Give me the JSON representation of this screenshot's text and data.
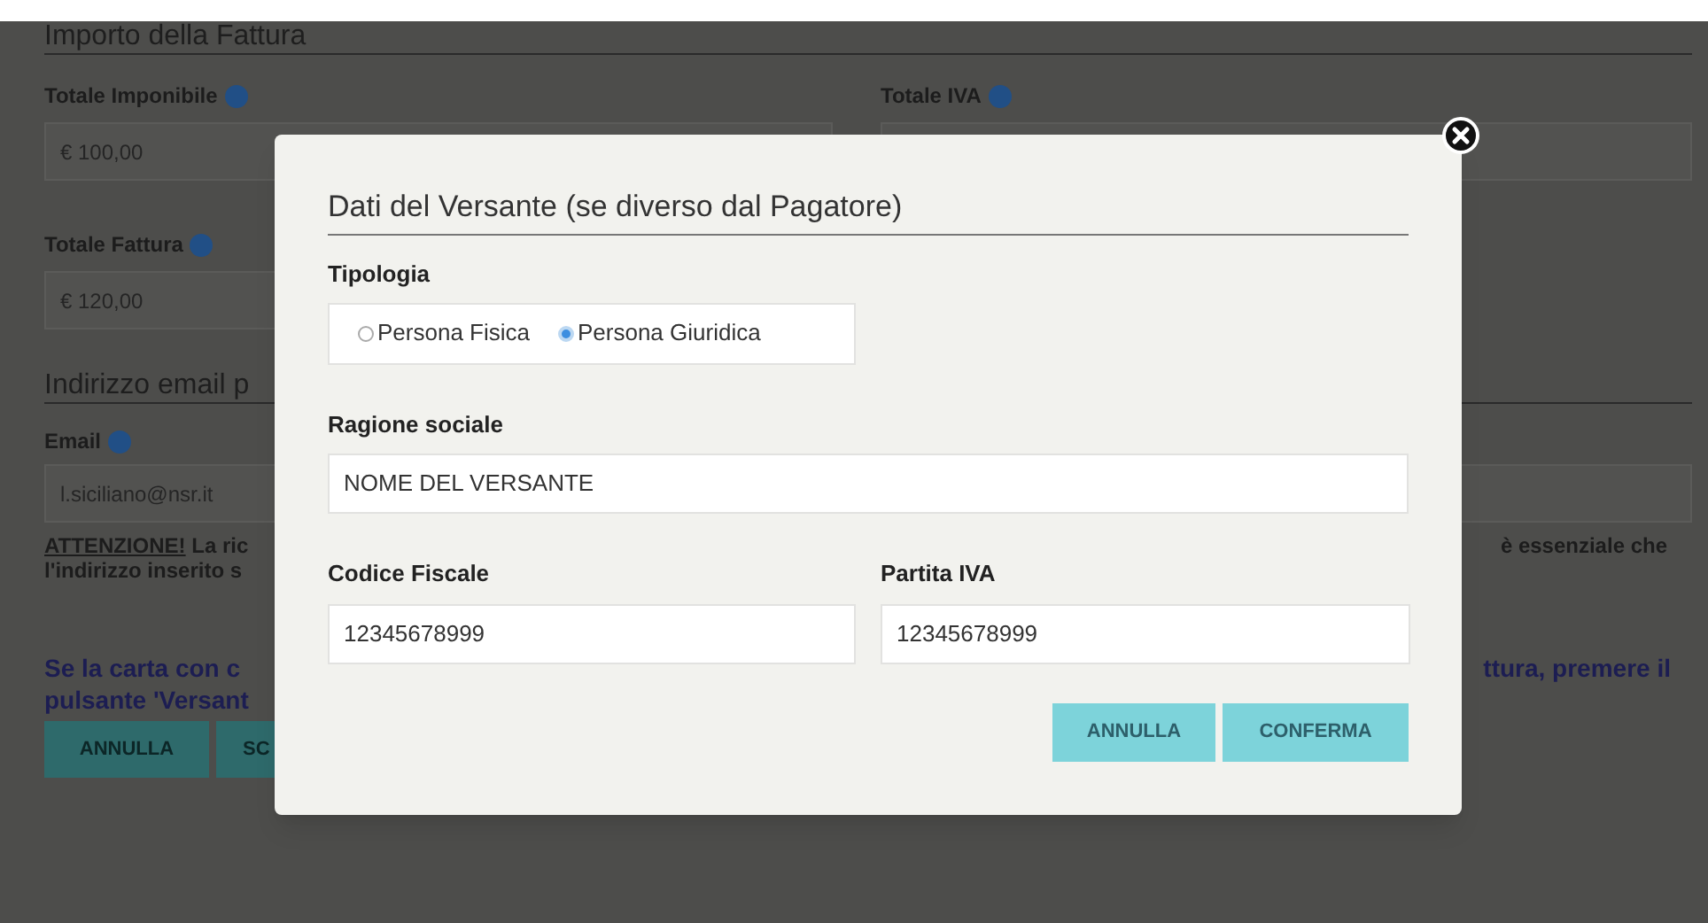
{
  "page": {
    "invoice_heading": "Importo della Fattura",
    "taxable_total": {
      "label": "Totale Imponibile",
      "value": "€ 100,00"
    },
    "vat_total": {
      "label": "Totale IVA"
    },
    "invoice_total": {
      "label": "Totale Fattura",
      "value": "€ 120,00"
    },
    "email_heading": "Indirizzo email p",
    "email": {
      "label": "Email",
      "value": "l.siciliano@nsr.it"
    },
    "warning": {
      "label": "ATTENZIONE!",
      "text_left": " La ric",
      "text_right": "è essenziale che",
      "line_2": "l'indirizzo inserito s"
    },
    "payer_note": {
      "line_1_left": "Se la carta con c",
      "line_1_right": "ttura, premere il",
      "line_2": "pulsante 'Versant"
    },
    "buttons": [
      "ANNULLA",
      "SC"
    ]
  },
  "modal": {
    "title": "Dati del Versante (se diverso dal Pagatore)",
    "type_label": "Tipologia",
    "type_options": [
      {
        "label": "Persona Fisica",
        "selected": false
      },
      {
        "label": "Persona Giuridica",
        "selected": true
      }
    ],
    "company_name": {
      "label": "Ragione sociale",
      "value": "NOME DEL VERSANTE"
    },
    "tax_code": {
      "label": "Codice Fiscale",
      "value": "12345678999"
    },
    "vat_number": {
      "label": "Partita IVA",
      "value": "12345678999"
    },
    "buttons": [
      "ANNULLA",
      "CONFERMA"
    ]
  }
}
